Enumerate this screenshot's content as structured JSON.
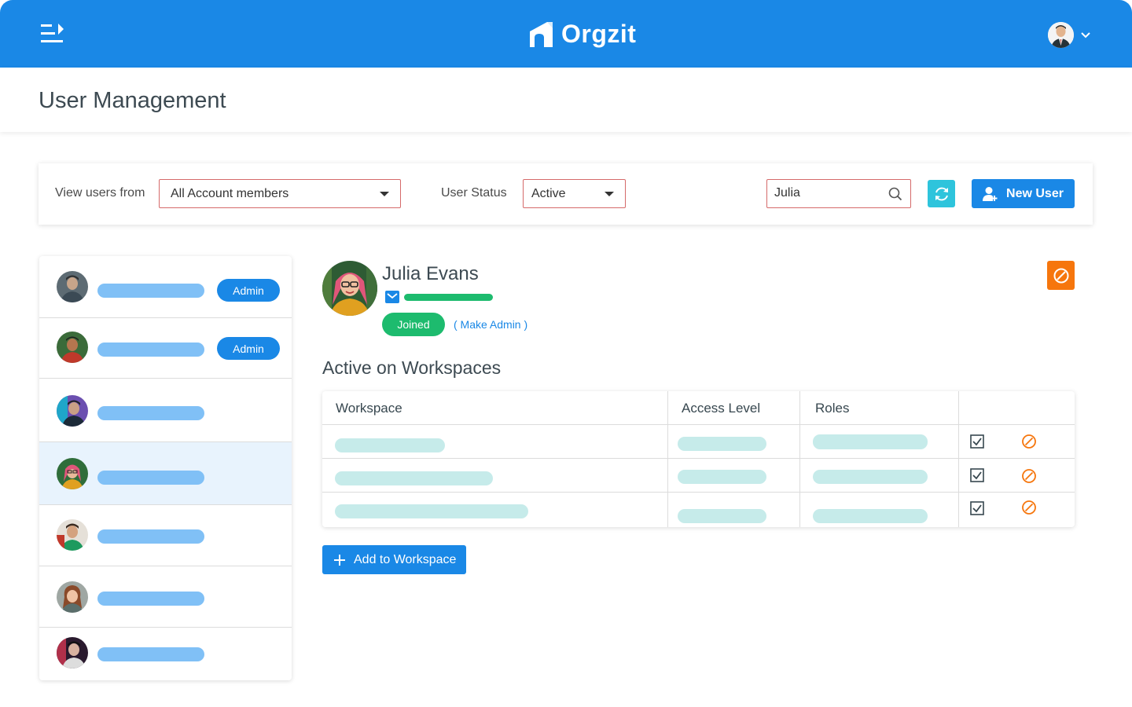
{
  "app": {
    "name": "Orgzit"
  },
  "page": {
    "title": "User Management"
  },
  "filters": {
    "view_users_label": "View users from",
    "view_users_value": "All Account members",
    "user_status_label": "User Status",
    "user_status_value": "Active",
    "search_value": "Julia",
    "new_user_label": "New User"
  },
  "users_list": [
    {
      "badge": "Admin"
    },
    {
      "badge": "Admin"
    },
    {
      "badge": ""
    },
    {
      "badge": "",
      "selected": true
    },
    {
      "badge": ""
    },
    {
      "badge": ""
    },
    {
      "badge": ""
    }
  ],
  "user_detail": {
    "name": "Julia Evans",
    "status_badge": "Joined",
    "make_admin_link": "( Make Admin )"
  },
  "workspaces": {
    "section_title": "Active on Workspaces",
    "columns": [
      "Workspace",
      "Access Level",
      "Roles"
    ],
    "add_button_label": "Add to Workspace"
  },
  "colors": {
    "primary": "#1a88e6",
    "success": "#1dbb6e",
    "warning": "#f6760d",
    "refresh": "#2ec4dc"
  }
}
